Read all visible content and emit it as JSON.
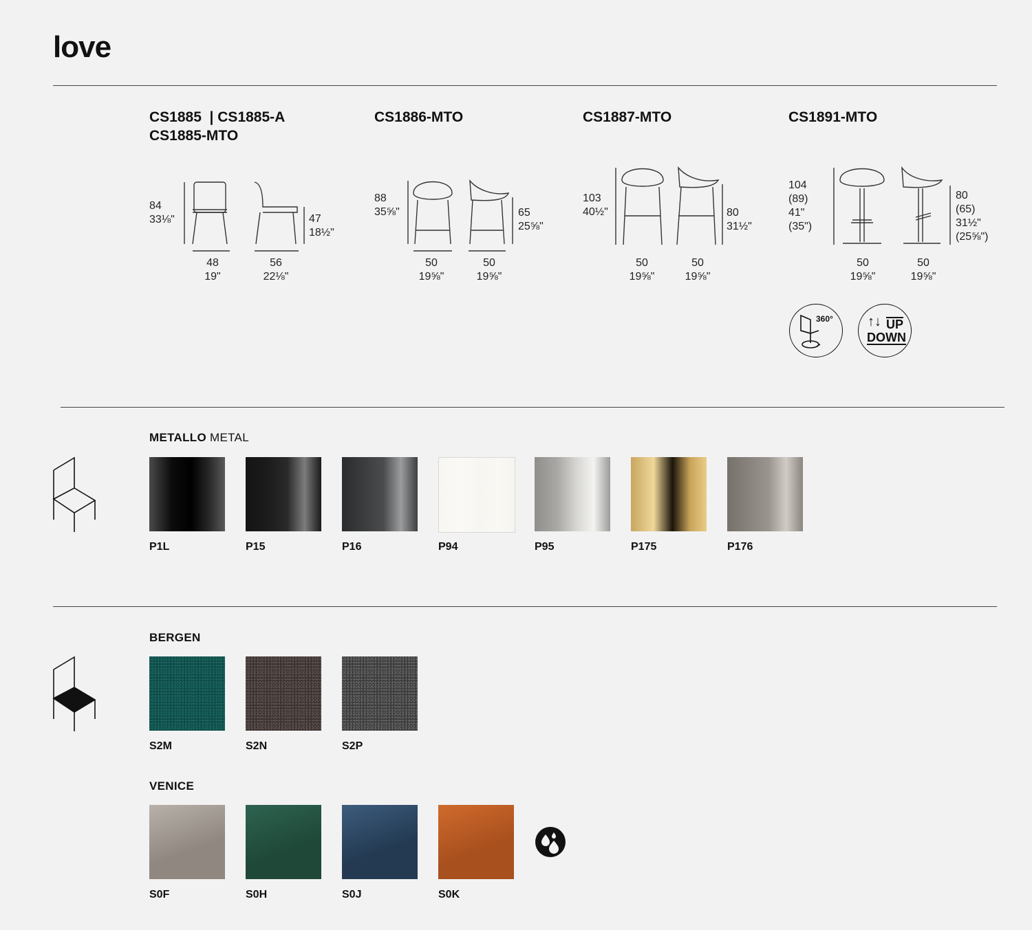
{
  "header": {
    "title": "love"
  },
  "models": [
    {
      "code_line1": "CS1885  | CS1885-A",
      "code_line2": "CS1885-MTO",
      "height_mm": "84",
      "height_in": "33⅛\"",
      "seat_mm": "47",
      "seat_in": "18½\"",
      "width_mm": "48",
      "width_in": "19\"",
      "depth_mm": "56",
      "depth_in": "22⅛\""
    },
    {
      "code_line1": "CS1886-MTO",
      "height_mm": "88",
      "height_in": "35⅝\"",
      "seat_mm": "65",
      "seat_in": "25⅝\"",
      "width_mm": "50",
      "width_in": "19⅝\"",
      "depth_mm": "50",
      "depth_in": "19⅝\""
    },
    {
      "code_line1": "CS1887-MTO",
      "height_mm": "103",
      "height_in": "40½\"",
      "seat_mm": "80",
      "seat_in": "31½\"",
      "width_mm": "50",
      "width_in": "19⅝\"",
      "depth_mm": "50",
      "depth_in": "19⅝\""
    },
    {
      "code_line1": "CS1891-MTO",
      "height_lines": [
        "104",
        "(89)",
        "41\"",
        "(35\")"
      ],
      "seat_lines": [
        "80",
        "(65)",
        "31½\"",
        "(25⅝\")"
      ],
      "width_mm": "50",
      "width_in": "19⅝\"",
      "depth_mm": "50",
      "depth_in": "19⅝\""
    }
  ],
  "badges": {
    "swivel": {
      "label": "360°",
      "icon": "swivel-360-icon"
    },
    "height_adjust": {
      "arrows": "↑↓",
      "up": "UP",
      "down": "DOWN",
      "icon": "up-down-icon"
    }
  },
  "metal": {
    "title_bold": "METALLO",
    "title_light": "METAL",
    "icon": "chair-frame-icon",
    "swatches": [
      {
        "code": "P1L",
        "colors": [
          "#4a4a4a",
          "#0b0b0b",
          "#000000",
          "#262626",
          "#5a5a5a"
        ]
      },
      {
        "code": "P15",
        "colors": [
          "#141414",
          "#1c1c1c",
          "#2a2a2a",
          "#7c7c7c",
          "#1a1a1a"
        ]
      },
      {
        "code": "P16",
        "colors": [
          "#2a2c2e",
          "#3b3d3f",
          "#4a4c4e",
          "#9a9c9e",
          "#3c3e40"
        ]
      },
      {
        "code": "P94",
        "colors": [
          "#f8f7f2",
          "#faf9f5",
          "#f7f6f1",
          "#f9f8f4",
          "#f6f5f0"
        ]
      },
      {
        "code": "P95",
        "colors": [
          "#8f8e8c",
          "#a9a8a5",
          "#d6d5d2",
          "#f3f3f1",
          "#9c9b98"
        ]
      },
      {
        "code": "P175",
        "colors": [
          "#c8a660",
          "#f0d89a",
          "#1a140a",
          "#c9a35a",
          "#e8cd86"
        ]
      },
      {
        "code": "P176",
        "colors": [
          "#77716b",
          "#8a847e",
          "#9b958f",
          "#d0cbc5",
          "#8b857f"
        ]
      }
    ]
  },
  "bergen": {
    "title": "BERGEN",
    "icon": "chair-seat-icon",
    "swatches": [
      {
        "code": "S2M",
        "base": "#0f4a46",
        "speck": "#1a6560"
      },
      {
        "code": "S2N",
        "base": "#3a3230",
        "speck": "#5c524d"
      },
      {
        "code": "S2P",
        "base": "#3b3b3b",
        "speck": "#626262"
      }
    ]
  },
  "venice": {
    "title": "VENICE",
    "icon": "water-repellent-icon",
    "swatches": [
      {
        "code": "S0F",
        "base": "#8f8780",
        "light": "#b8b1aa"
      },
      {
        "code": "S0H",
        "base": "#1f4838",
        "light": "#2e6350"
      },
      {
        "code": "S0J",
        "base": "#233a52",
        "light": "#3d5c7d"
      },
      {
        "code": "S0K",
        "base": "#a8501e",
        "light": "#d06a2c"
      }
    ]
  }
}
